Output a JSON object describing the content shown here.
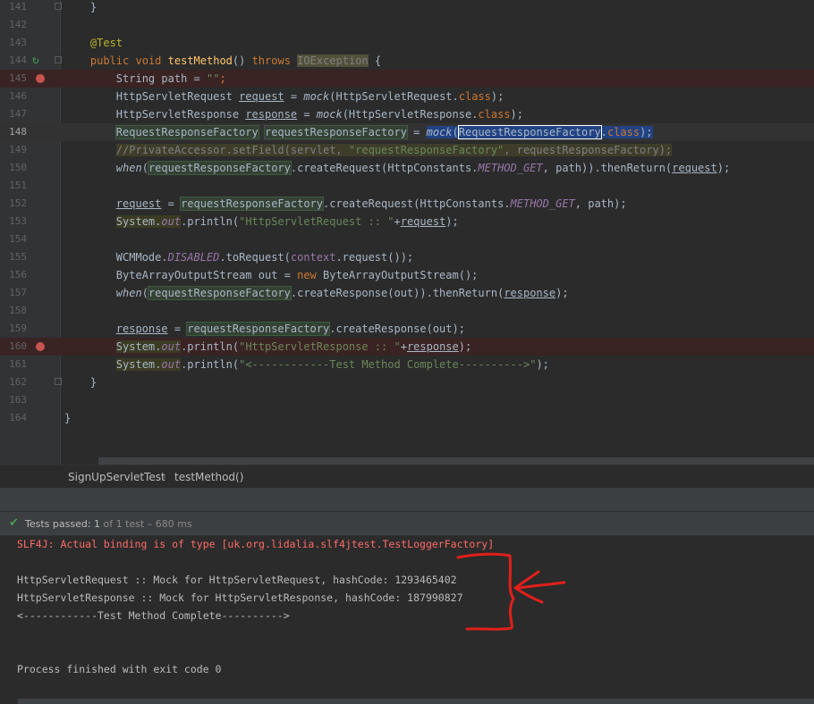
{
  "editor": {
    "lines": [
      {
        "num": "141"
      },
      {
        "num": "142"
      },
      {
        "num": "143"
      },
      {
        "num": "144"
      },
      {
        "num": "145"
      },
      {
        "num": "146"
      },
      {
        "num": "147"
      },
      {
        "num": "148"
      },
      {
        "num": "149"
      },
      {
        "num": "150"
      },
      {
        "num": "151"
      },
      {
        "num": "152"
      },
      {
        "num": "153"
      },
      {
        "num": "154"
      },
      {
        "num": "155"
      },
      {
        "num": "156"
      },
      {
        "num": "157"
      },
      {
        "num": "158"
      },
      {
        "num": "159"
      },
      {
        "num": "160"
      },
      {
        "num": "161"
      },
      {
        "num": "162"
      },
      {
        "num": "163"
      },
      {
        "num": "164"
      }
    ],
    "tokens": {
      "brace_close": "}",
      "brace_open": "{",
      "annotation": "@Test",
      "kw_public": "public",
      "kw_void": "void",
      "method_name": "testMethod",
      "parens": "()",
      "kw_throws": "throws",
      "ioexception": "IOException",
      "string_type": "String",
      "path_var": "path",
      "eq": " = ",
      "empty_str": "\"\"",
      "semi": ";",
      "req_type": "HttpServletRequest",
      "request_var": "request",
      "mock": "mock",
      "req_class_arg": "(HttpServletRequest.",
      "kw_class": "class",
      "close_semi": ");",
      "resp_type": "HttpServletResponse",
      "response_var": "response",
      "resp_class_arg": "(HttpServletResponse.",
      "rrf_type": "RequestResponseFactory",
      "rrf_var": "requestResponseFactory",
      "open_paren": "(",
      "dot": ".",
      "comment_a": "//PrivateAccessor.setField(servlet, ",
      "comment_str": "\"requestResponseFactory\"",
      "comment_b": ", ",
      "comment_c": "requestResponseFactory",
      "comment_end": ");",
      "when": "when",
      "create_request": ".createRequest(HttpConstants.",
      "method_get": "METHOD_GET",
      "path_args": ", path)).thenReturn(",
      "path_end": ", path);",
      "system": "System.",
      "out": "out",
      "println": ".println(",
      "str_req": "\"HttpServletRequest :: \"",
      "plus": "+",
      "wcm": "WCMMode.",
      "disabled": "DISABLED",
      "to_request": ".toRequest(",
      "context": "context",
      "context_rest": ".request());",
      "baos_decl": "ByteArrayOutputStream out = ",
      "kw_new": "new",
      "baos_new": " ByteArrayOutputStream();",
      "create_response_out": ".createResponse(out)).thenReturn(",
      "create_response_out_end": ".createResponse(out);",
      "str_resp": "\"HttpServletResponse :: \"",
      "str_complete": "\"<------------Test Method Complete---------->\""
    }
  },
  "breadcrumb": {
    "class_name": "SignUpServletTest",
    "separator": "›",
    "method_name": "testMethod()"
  },
  "status": {
    "label": "Tests passed:",
    "count": "1",
    "detail": "of 1 test – 680 ms"
  },
  "console": {
    "lines": [
      "SLF4J: Actual binding is of type [uk.org.lidalia.slf4jtest.TestLoggerFactory]",
      "HttpServletRequest :: Mock for HttpServletRequest, hashCode: 1293465402",
      "HttpServletResponse :: Mock for HttpServletResponse, hashCode: 187990827",
      "<------------Test Method Complete---------->",
      "Process finished with exit code 0"
    ]
  },
  "colors": {
    "annotation_red": "#e0201a",
    "pass_green": "#499c54",
    "error_red": "#ff6b68"
  }
}
